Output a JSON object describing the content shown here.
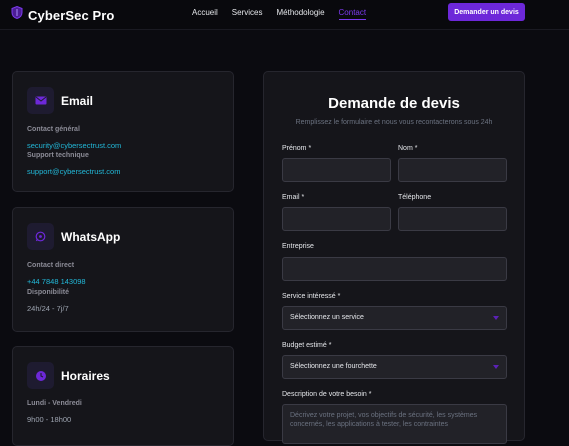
{
  "header": {
    "brand": "CyberSec Pro",
    "nav": [
      {
        "label": "Accueil"
      },
      {
        "label": "Services"
      },
      {
        "label": "Méthodologie"
      },
      {
        "label": "Contact"
      }
    ],
    "cta_label": "Demander un devis"
  },
  "contact_cards": {
    "email": {
      "title": "Email",
      "label1": "Contact général",
      "value1": "security@cybersectrust.com",
      "label2": "Support technique",
      "value2": "support@cybersectrust.com"
    },
    "whatsapp": {
      "title": "WhatsApp",
      "label1": "Contact direct",
      "value1": "+44 7848 143098",
      "label2": "Disponibilité",
      "value2": "24h/24 - 7j/7"
    },
    "hours": {
      "title": "Horaires",
      "label1": "Lundi - Vendredi",
      "value1": "9h00 - 18h00"
    }
  },
  "form": {
    "title": "Demande de devis",
    "subtitle": "Remplissez le formulaire et nous vous recontacterons sous 24h",
    "first_name_label": "Prénom *",
    "last_name_label": "Nom *",
    "email_label": "Email *",
    "phone_label": "Téléphone",
    "company_label": "Entreprise",
    "service_label": "Service intéressé *",
    "service_value": "Sélectionnez un service",
    "budget_label": "Budget estimé *",
    "budget_value": "Sélectionnez une fourchette",
    "description_label": "Description de votre besoin *",
    "description_placeholder": "Décrivez votre projet, vos objectifs de sécurité, les systèmes concernés, les applications à tester, les contraintes"
  },
  "colors": {
    "accent": "#6d28d9",
    "link": "#22b8d8",
    "background": "#0b0b10",
    "card": "#15151a"
  },
  "icons": [
    "shield-icon",
    "mail-icon",
    "whatsapp-icon",
    "clock-icon",
    "chevron-down-icon"
  ]
}
